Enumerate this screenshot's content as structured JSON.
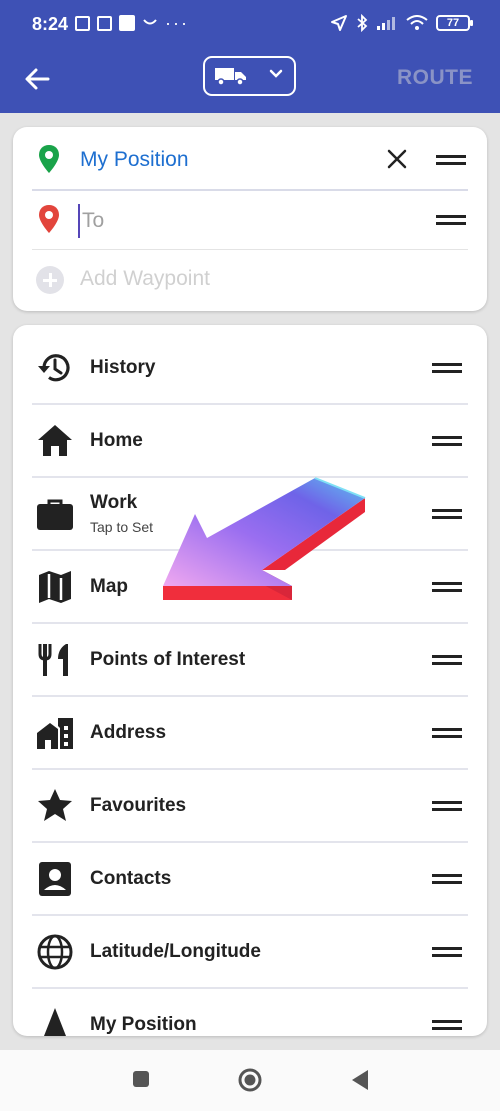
{
  "status_bar": {
    "time": "8:24",
    "battery": "77"
  },
  "app_bar": {
    "route_label": "ROUTE",
    "vehicle": "truck-icon"
  },
  "route_card": {
    "from_label": "My Position",
    "to_placeholder": "To",
    "to_value": "",
    "add_waypoint_label": "Add Waypoint"
  },
  "destinations": {
    "items": [
      {
        "label": "History",
        "icon": "history-icon"
      },
      {
        "label": "Home",
        "icon": "home-icon"
      },
      {
        "label": "Work",
        "sub": "Tap to Set",
        "icon": "briefcase-icon"
      },
      {
        "label": "Map",
        "icon": "map-icon"
      },
      {
        "label": "Points of Interest",
        "icon": "restaurant-icon"
      },
      {
        "label": "Address",
        "icon": "address-icon"
      },
      {
        "label": "Favourites",
        "icon": "star-icon"
      },
      {
        "label": "Contacts",
        "icon": "contact-icon"
      },
      {
        "label": "Latitude/Longitude",
        "icon": "globe-icon"
      },
      {
        "label": "My Position",
        "icon": "navigation-arrow-icon"
      }
    ]
  },
  "colors": {
    "primary": "#3e51b5",
    "from_text": "#1e6fd0",
    "pin_green": "#1aa34a",
    "pin_red": "#e2453c"
  }
}
